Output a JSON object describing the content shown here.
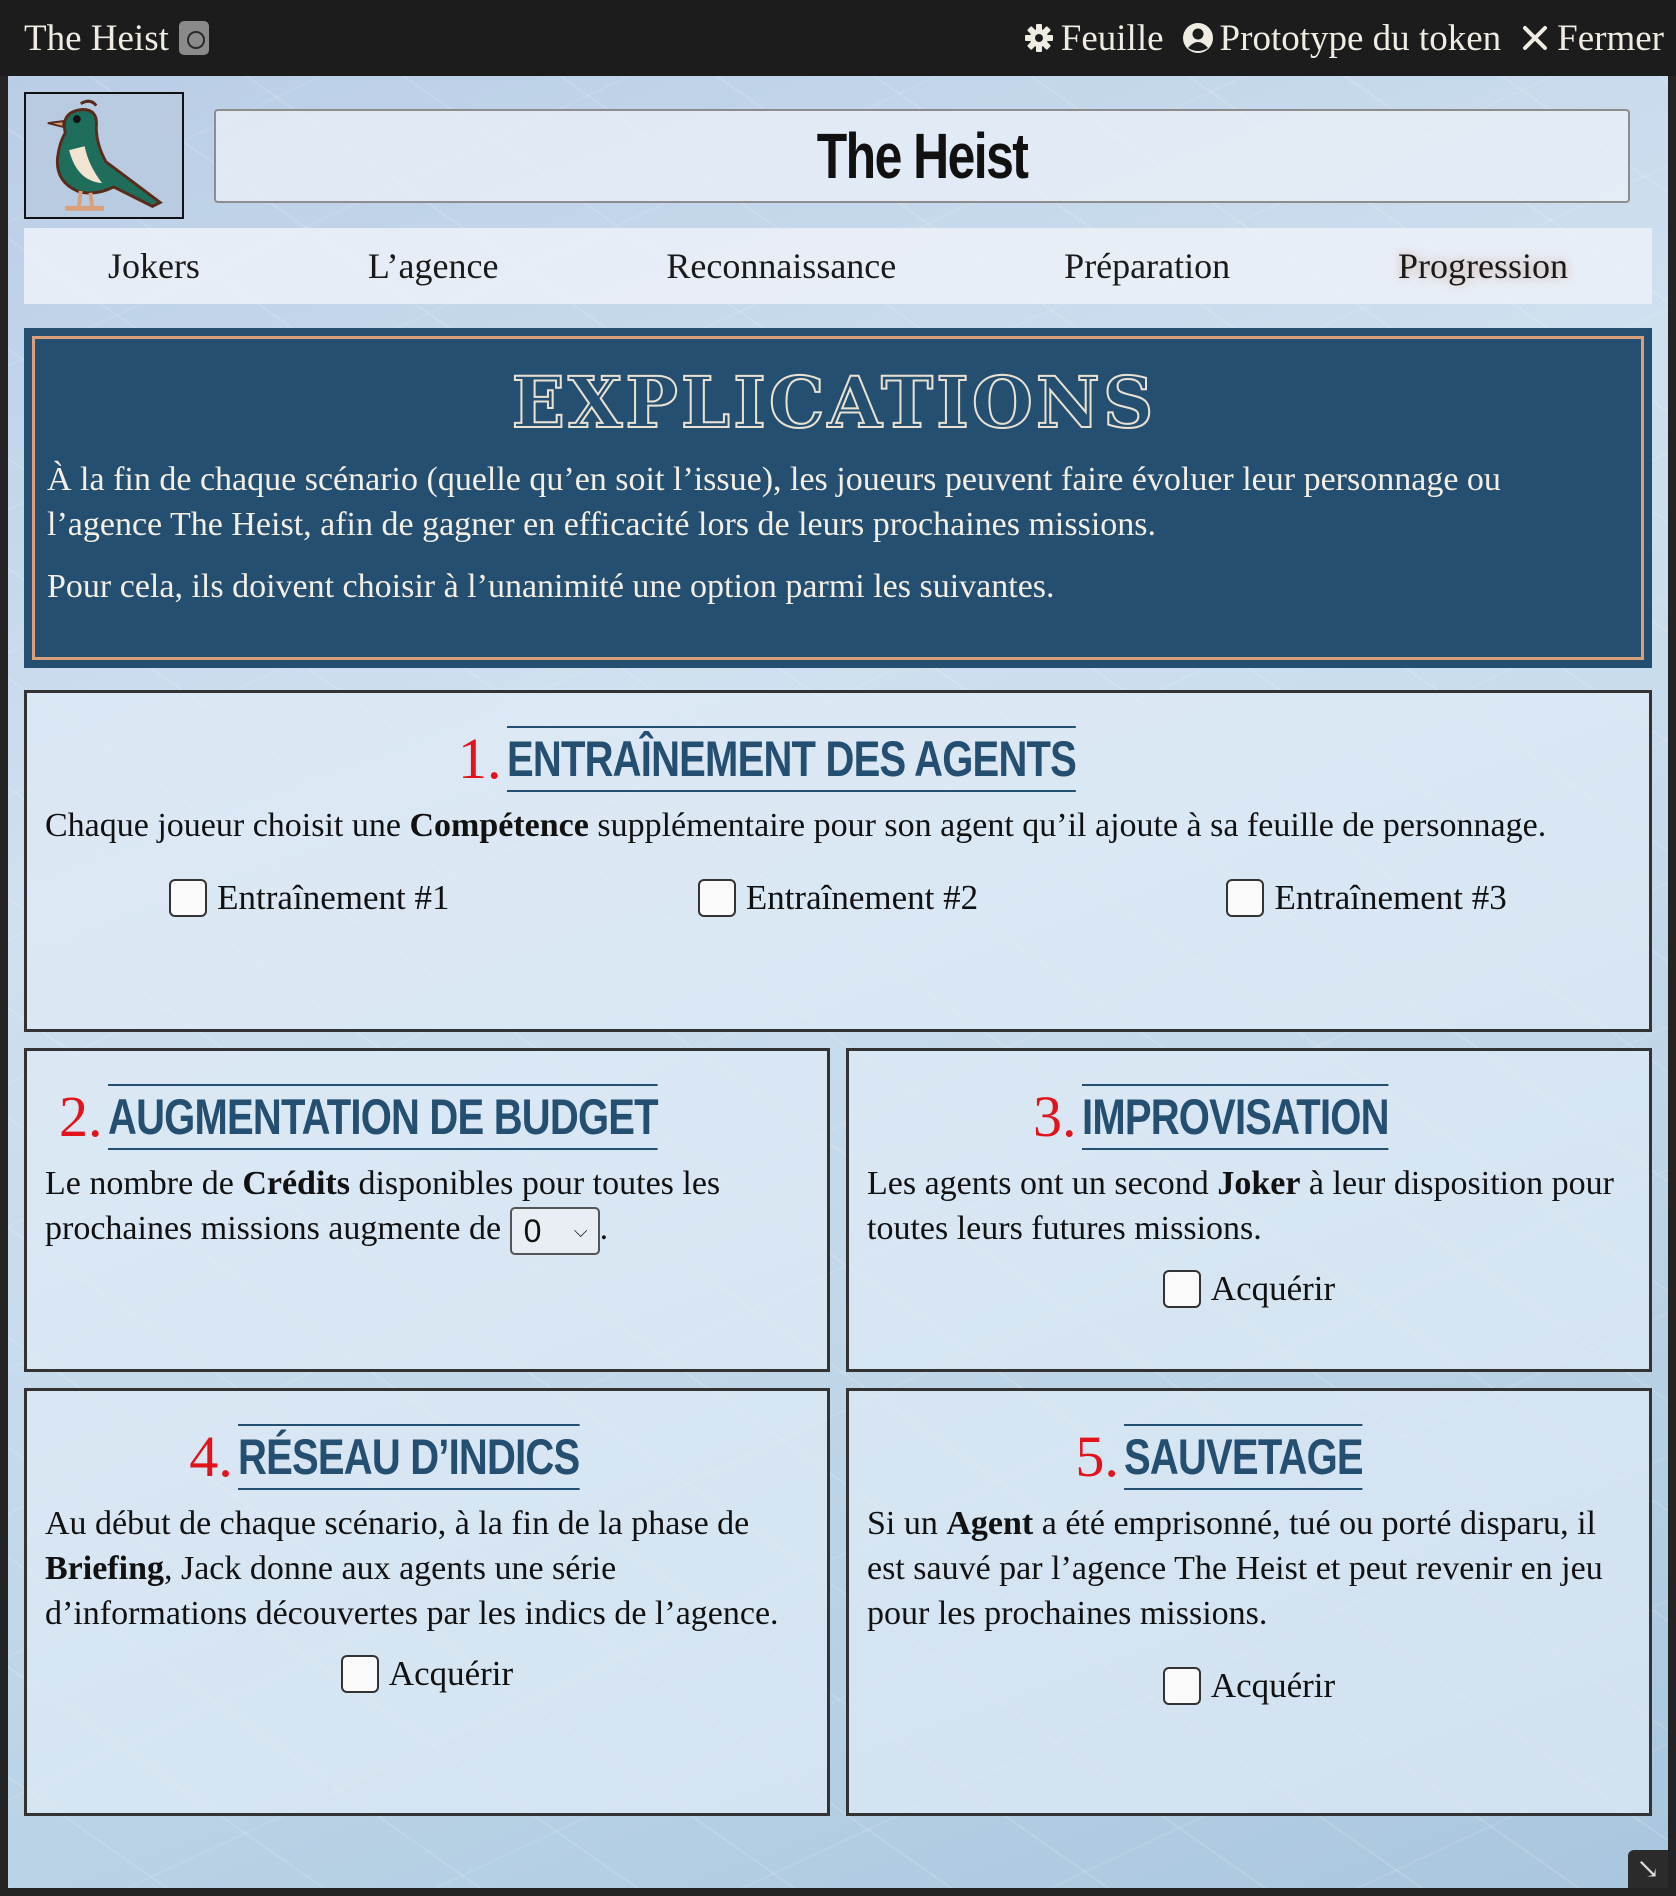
{
  "window": {
    "title": "The Heist",
    "controls": {
      "sheet_label": "Feuille",
      "token_label": "Prototype du token",
      "close_label": "Fermer"
    }
  },
  "header": {
    "name": "The Heist"
  },
  "tabs": [
    {
      "label": "Jokers"
    },
    {
      "label": "L’agence"
    },
    {
      "label": "Reconnaissance"
    },
    {
      "label": "Préparation"
    },
    {
      "label": "Progression"
    }
  ],
  "active_tab": "Progression",
  "explications": {
    "title": "EXPLICATIONS",
    "p1": "À la fin de chaque scénario (quelle qu’en soit l’issue), les joueurs peuvent faire évoluer leur personnage ou l’agence The Heist, afin de gagner en efficacité lors de leurs prochaines missions.",
    "p2": "Pour cela, ils doivent choisir à l’unanimité une option parmi les suivantes."
  },
  "options": {
    "training": {
      "num": "1.",
      "title": "ENTRAÎNEMENT DES AGENTS",
      "text_a": "Chaque joueur choisit une ",
      "text_b": "Compétence",
      "text_c": " supplémentaire pour son agent qu’il ajoute à sa feuille de personnage.",
      "checks": [
        "Entraînement #1",
        "Entraînement #2",
        "Entraînement #3"
      ]
    },
    "budget": {
      "num": "2.",
      "title": "AUGMENTATION DE BUDGET",
      "text_a": "Le nombre de ",
      "text_b": "Crédits",
      "text_c": " disponibles pour toutes les prochaines missions augmente de ",
      "text_d": ".",
      "select_value": "0"
    },
    "improvisation": {
      "num": "3.",
      "title": "IMPROVISATION",
      "text_a": "Les agents ont un second ",
      "text_b": "Joker",
      "text_c": " à leur disposition pour toutes leurs futures missions.",
      "check": "Acquérir"
    },
    "network": {
      "num": "4.",
      "title": "RÉSEAU D’INDICS",
      "text_a": "Au début de chaque scénario, à la fin de la phase de ",
      "text_b": "Briefing",
      "text_c": ", Jack donne aux agents une série d’informations découvertes par les indics de l’agence.",
      "check": "Acquérir"
    },
    "rescue": {
      "num": "5.",
      "title": "SAUVETAGE",
      "text_a": "Si un ",
      "text_b": "Agent",
      "text_c": " a été emprisonné, tué ou porté disparu, il est sauvé par l’agence The Heist et peut revenir en jeu pour les prochaines missions.",
      "check": "Acquérir"
    }
  },
  "colors": {
    "accent_red": "#e2131b",
    "title_blue": "#244f71",
    "explications_border": "#d9a07c"
  }
}
